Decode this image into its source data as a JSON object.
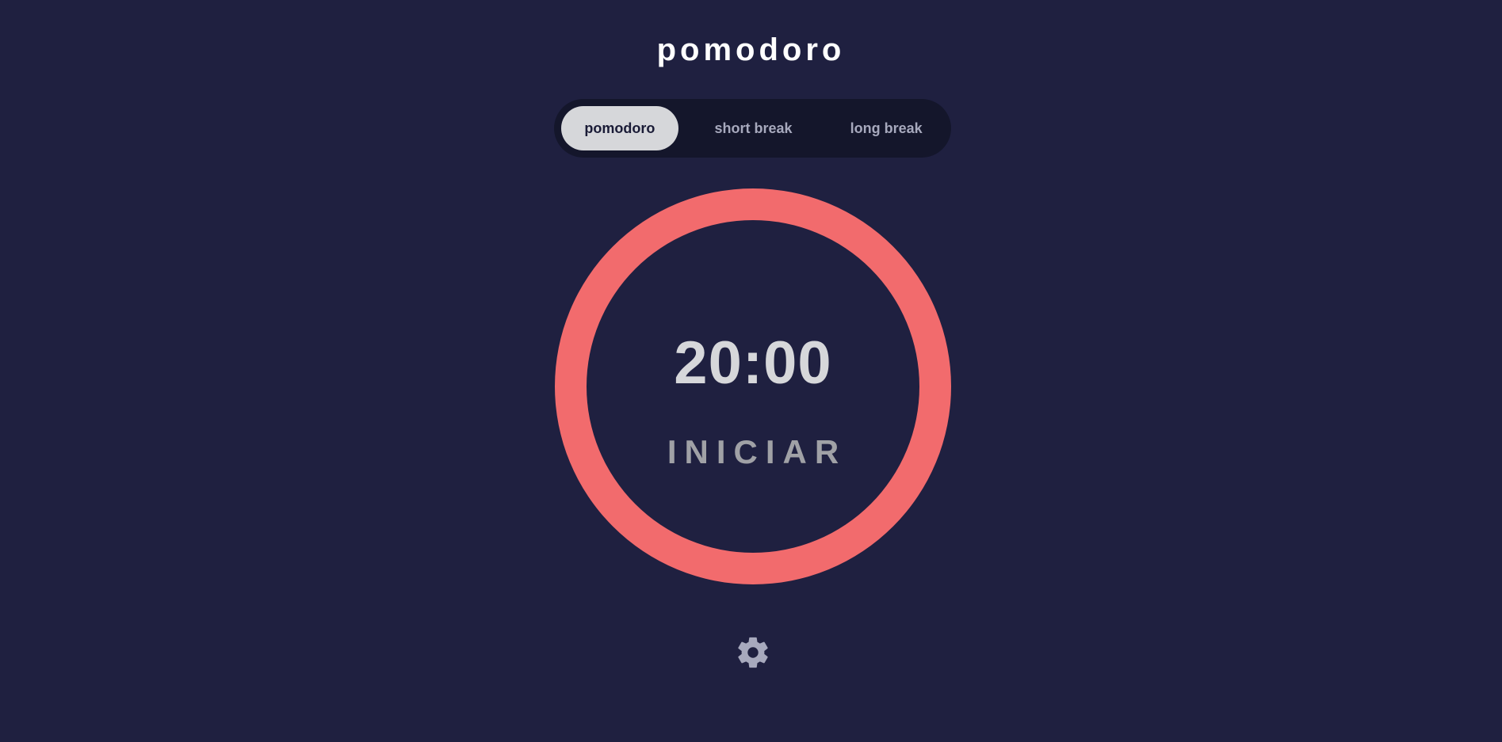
{
  "app": {
    "title": "pomodoro"
  },
  "mode_tabs": [
    {
      "label": "pomodoro",
      "active": true
    },
    {
      "label": "short break",
      "active": false
    },
    {
      "label": "long break",
      "active": false
    }
  ],
  "timer": {
    "time": "20:00",
    "start_label": "INICIAR",
    "progress": 1.0
  },
  "settings": {
    "icon": "gear-icon"
  },
  "colors": {
    "background": "#1f2040",
    "accent": "#f26b6d",
    "tab_bar": "#14162b",
    "active_tab": "#d6d7da"
  }
}
